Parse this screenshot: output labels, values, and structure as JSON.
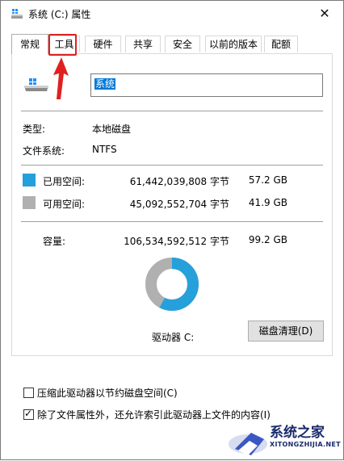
{
  "window": {
    "title": "系统 (C:) 属性",
    "close_glyph": "✕"
  },
  "tabs": [
    {
      "label": "常规",
      "active": true
    },
    {
      "label": "工具",
      "active": false,
      "highlighted": true
    },
    {
      "label": "硬件",
      "active": false
    },
    {
      "label": "共享",
      "active": false
    },
    {
      "label": "安全",
      "active": false
    },
    {
      "label": "以前的版本",
      "active": false
    },
    {
      "label": "配额",
      "active": false
    }
  ],
  "drive": {
    "name_value": "系统",
    "icon": "drive-icon"
  },
  "info": {
    "type_label": "类型:",
    "type_value": "本地磁盘",
    "fs_label": "文件系统:",
    "fs_value": "NTFS"
  },
  "space": {
    "used_label": "已用空间:",
    "used_bytes": "61,442,039,808 字节",
    "used_gb": "57.2 GB",
    "free_label": "可用空间:",
    "free_bytes": "45,092,552,704 字节",
    "free_gb": "41.9 GB",
    "capacity_label": "容量:",
    "capacity_bytes": "106,534,592,512 字节",
    "capacity_gb": "99.2 GB",
    "used_fraction": 0.577,
    "used_color": "#26a0da",
    "free_color": "#b0b0b0"
  },
  "drive_label": "驱动器 C:",
  "cleanup_button": "磁盘清理(D)",
  "options": [
    {
      "label": "压缩此驱动器以节约磁盘空间(C)",
      "checked": false
    },
    {
      "label": "除了文件属性外，还允许索引此驱动器上文件的内容(I)",
      "checked": true
    }
  ],
  "watermark": {
    "name": "系统之家",
    "url": "XITONGZHIJIA.NET"
  }
}
